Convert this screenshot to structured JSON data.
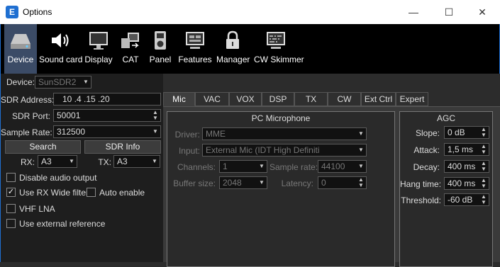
{
  "window": {
    "title": "Options",
    "app_icon": "E",
    "controls": {
      "minimize": "—",
      "maximize": "☐",
      "close": "✕"
    }
  },
  "toolbar": [
    {
      "label": "Device",
      "icon": "hard-drive-icon",
      "selected": true
    },
    {
      "label": "Sound card",
      "icon": "speaker-icon",
      "selected": false
    },
    {
      "label": "Display",
      "icon": "monitor-icon",
      "selected": false
    },
    {
      "label": "CAT",
      "icon": "cat-connection-icon",
      "selected": false
    },
    {
      "label": "Panel",
      "icon": "panel-icon",
      "selected": false
    },
    {
      "label": "Features",
      "icon": "features-icon",
      "selected": false
    },
    {
      "label": "Manager",
      "icon": "lock-icon",
      "selected": false
    },
    {
      "label": "CW Skimmer",
      "icon": "cw-skimmer-icon",
      "selected": false
    }
  ],
  "device": {
    "label": "Device:",
    "value": "SunSDR2",
    "sdr_address_label": "SDR Address:",
    "sdr_address": "10 .4 .15 .20",
    "sdr_port_label": "SDR Port:",
    "sdr_port": "50001",
    "sample_rate_label": "Sample Rate:",
    "sample_rate": "312500",
    "search": "Search",
    "sdr_info": "SDR Info",
    "rx_label": "RX:",
    "rx": "A3",
    "tx_label": "TX:",
    "tx": "A3",
    "checks": {
      "disable_audio": {
        "label": "Disable audio output",
        "checked": false
      },
      "rx_wide": {
        "label": "Use RX Wide filter",
        "checked": true
      },
      "auto_enable": {
        "label": "Auto enable",
        "checked": false
      },
      "vhf_lna": {
        "label": "VHF LNA",
        "checked": false
      },
      "ext_ref": {
        "label": "Use external reference",
        "checked": false
      }
    }
  },
  "tabs": [
    "Mic",
    "VAC",
    "VOX",
    "DSP",
    "TX",
    "CW",
    "Ext Ctrl",
    "Expert"
  ],
  "active_tab": "Mic",
  "pc_mic": {
    "title": "PC Microphone",
    "driver_label": "Driver:",
    "driver": "MME",
    "input_label": "Input:",
    "input": "External Mic (IDT High Definiti",
    "channels_label": "Channels:",
    "channels": "1",
    "sample_rate_label": "Sample rate:",
    "sample_rate": "44100",
    "buffer_label": "Buffer size:",
    "buffer": "2048",
    "latency_label": "Latency:",
    "latency": "0"
  },
  "agc": {
    "title": "AGC",
    "slope_label": "Slope:",
    "slope": "0 dB",
    "attack_label": "Attack:",
    "attack": "1,5 ms",
    "decay_label": "Decay:",
    "decay": "400 ms",
    "hang_label": "Hang time:",
    "hang": "400 ms",
    "threshold_label": "Threshold:",
    "threshold": "-60 dB"
  },
  "colors": {
    "accent": "#1f6fd1",
    "toolbar_bg": "#000000",
    "selected_tab_bg": "#3b4b66",
    "pane_bg": "#1e1e1e"
  }
}
